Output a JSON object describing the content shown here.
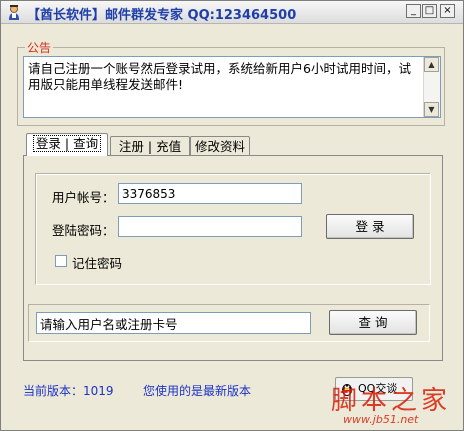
{
  "window": {
    "title": "【酋长软件】邮件群发专家  QQ:123464500",
    "controls": {
      "minimize": "_",
      "maximize": "□",
      "close": "×"
    }
  },
  "notice": {
    "legend": "公告",
    "text": "请自己注册一个账号然后登录试用，系统给新用户6小时试用时间，试用版只能用单线程发送邮件!"
  },
  "tabs": [
    {
      "label": "登录 | 查询",
      "active": true
    },
    {
      "label": "注册 | 充值",
      "active": false
    },
    {
      "label": "修改资料",
      "active": false
    }
  ],
  "login": {
    "username_label": "用户帐号：",
    "username_value": "3376853",
    "password_label": "登陆密码：",
    "password_value": "",
    "login_button": "登 录",
    "remember_label": "记住密码",
    "remember_checked": false
  },
  "query": {
    "input_value": "请输入用户名或注册卡号",
    "button": "查 询"
  },
  "status": {
    "version_text": "当前版本：1019",
    "update_text": "您使用的是最新版本"
  },
  "qq_chat": {
    "label": "QQ交谈"
  },
  "watermark": {
    "text": "脚本之家",
    "url": "www.jb51.net"
  },
  "colors": {
    "title_blue": "#1e3fa8",
    "status_blue": "#1a32c8",
    "legend_red": "#d43020",
    "watermark_red": "#d81e06",
    "window_bg": "#ece9d8"
  }
}
